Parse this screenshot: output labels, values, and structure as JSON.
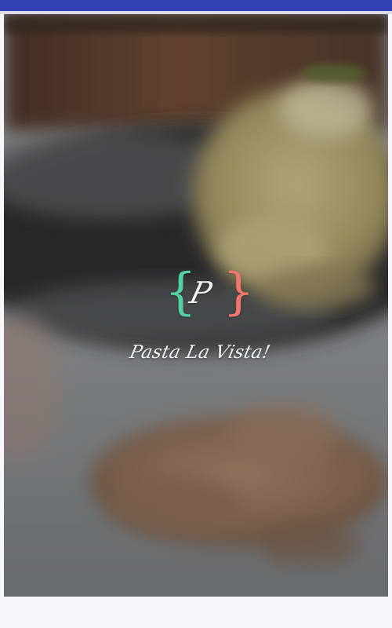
{
  "status_bar": {
    "color": "#3140b2"
  },
  "splash": {
    "background_image": "blurred pasta dish with walnuts",
    "logo": {
      "left_brace": "{",
      "monogram": "P",
      "right_brace": "}",
      "left_brace_color": "#54d1a2",
      "right_brace_color": "#f3776b"
    },
    "title": "Pasta La Vista!"
  }
}
